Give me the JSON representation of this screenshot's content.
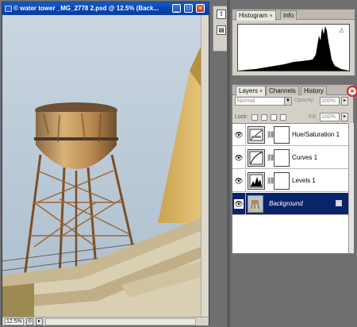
{
  "document": {
    "title": "© water tower _MG_2778 2.psd @ 12.5% (Back...",
    "zoom": "12.5%"
  },
  "histogram_panel": {
    "tabs": [
      {
        "label": "Histogram",
        "active": true
      },
      {
        "label": "Info",
        "active": false
      }
    ],
    "warning": "⚠"
  },
  "layers_panel": {
    "tabs": [
      {
        "label": "Layers",
        "active": true
      },
      {
        "label": "Channels",
        "active": false
      },
      {
        "label": "History",
        "active": false
      }
    ],
    "blend_mode": "Normal",
    "opacity_label": "Opacity:",
    "opacity": "100%",
    "lock_label": "Lock:",
    "fill_label": "Fill:",
    "fill": "100%",
    "layers": [
      {
        "name": "Hue/Saturation 1",
        "kind": "adjustment",
        "visible": true,
        "selected": false
      },
      {
        "name": "Curves 1",
        "kind": "adjustment",
        "visible": true,
        "selected": false
      },
      {
        "name": "Levels 1",
        "kind": "adjustment",
        "visible": true,
        "selected": false
      },
      {
        "name": "Background",
        "kind": "image",
        "visible": true,
        "selected": true
      }
    ]
  },
  "colors": {
    "title_bar": "#0a3fa8",
    "selection": "#0a246a",
    "highlight_ring": "#e0201c"
  }
}
